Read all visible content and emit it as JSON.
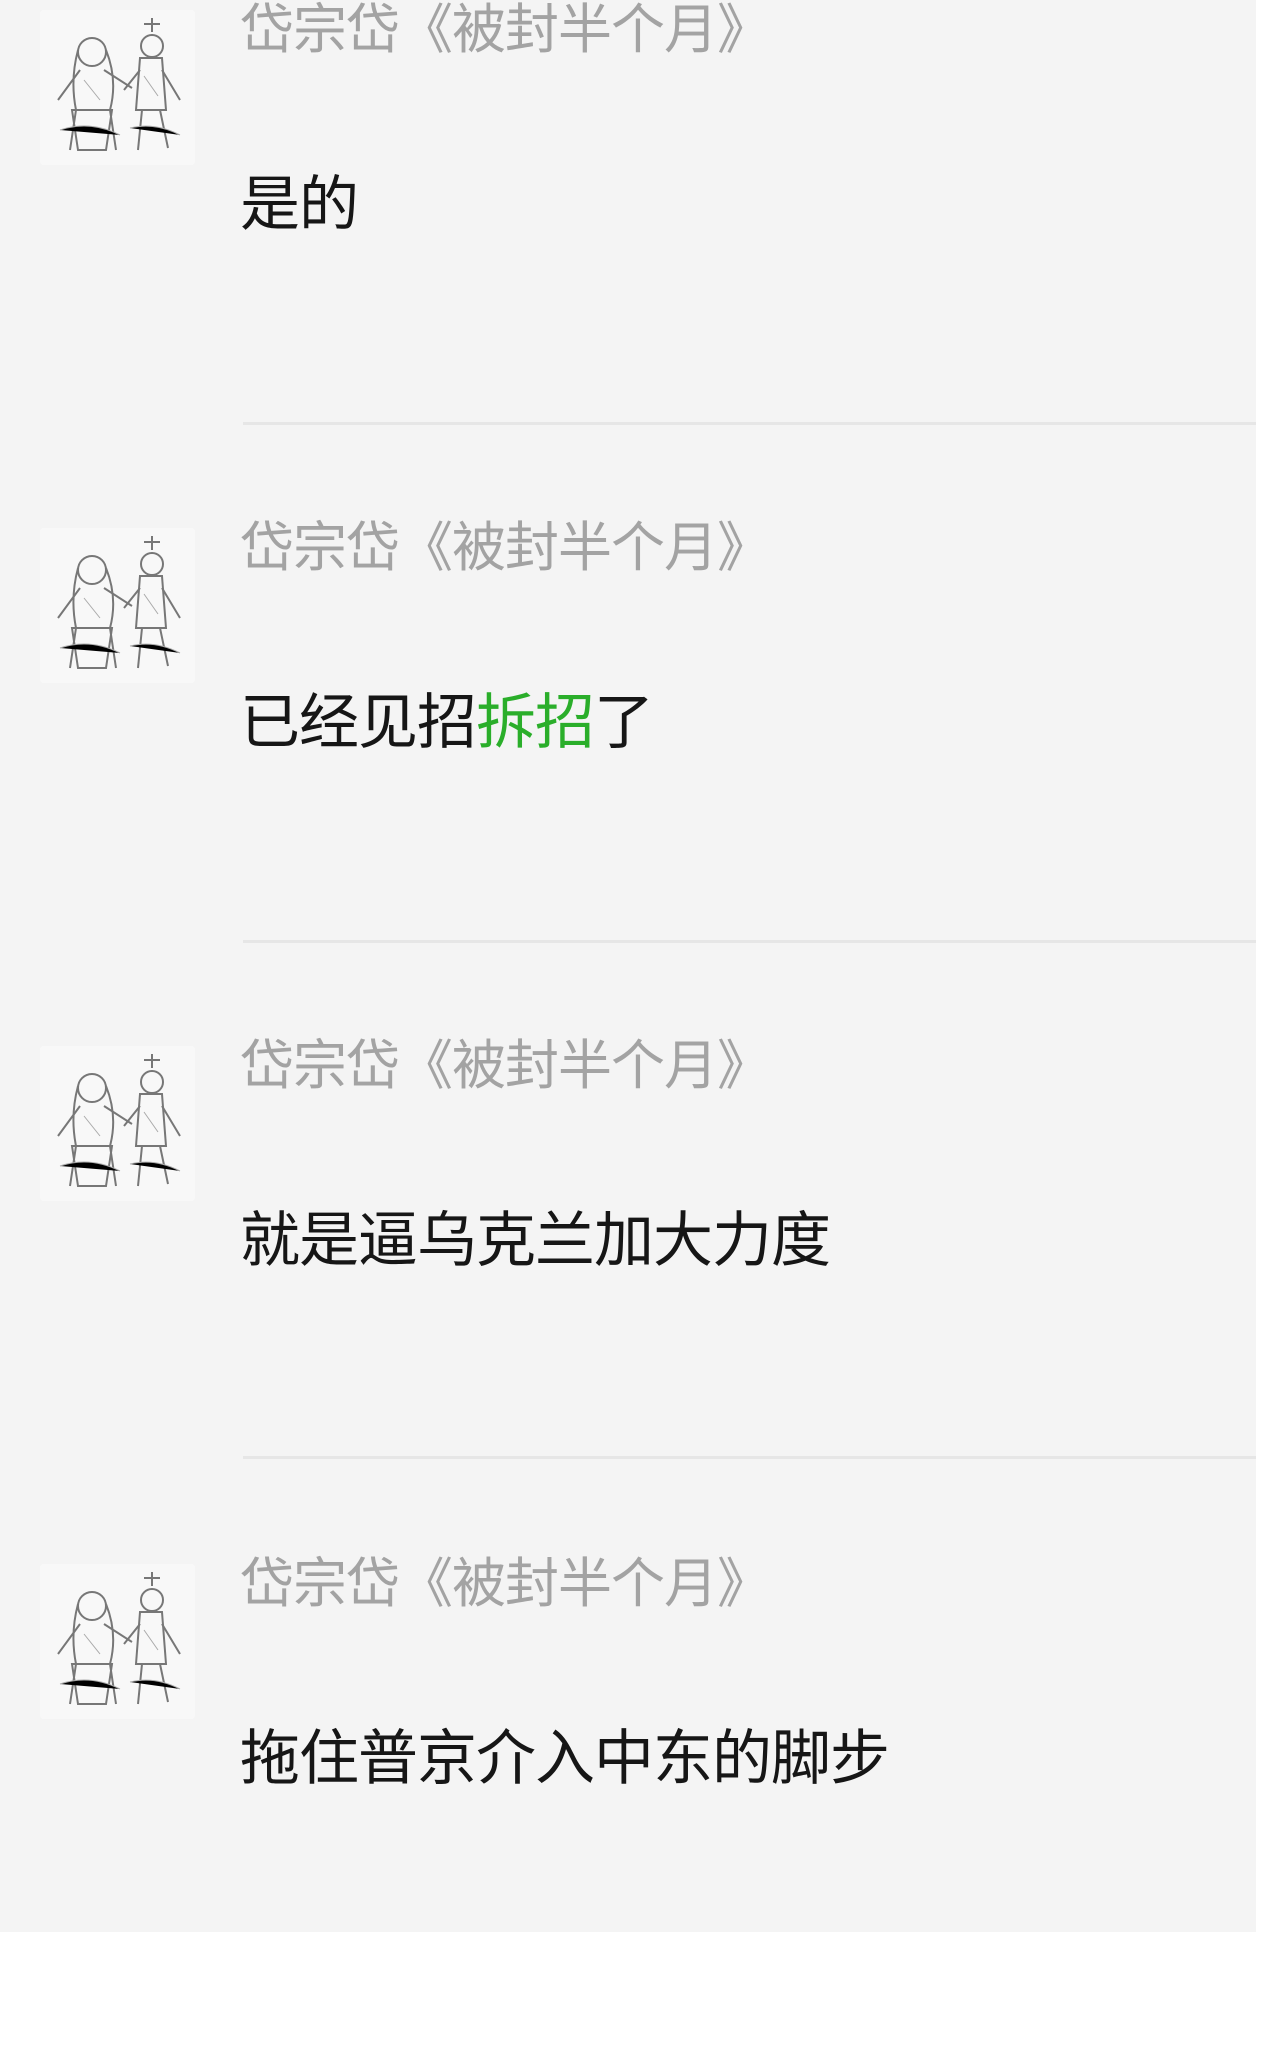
{
  "comments": [
    {
      "author": "岱宗岱《被封半个月》",
      "text_before": "是的",
      "text_highlight": "",
      "text_after": ""
    },
    {
      "author": "岱宗岱《被封半个月》",
      "text_before": "已经见招",
      "text_highlight": "拆招",
      "text_after": "了"
    },
    {
      "author": "岱宗岱《被封半个月》",
      "text_before": "就是逼乌克兰加大力度",
      "text_highlight": "",
      "text_after": ""
    },
    {
      "author": "岱宗岱《被封半个月》",
      "text_before": "拖住普京介入中东的脚步",
      "text_highlight": "",
      "text_after": ""
    }
  ],
  "colors": {
    "background": "#f4f4f4",
    "author": "#a3a3a3",
    "text": "#161616",
    "highlight": "#2aae2a",
    "divider": "#e6e6e6"
  },
  "icons": {
    "avatar": "sketch-avatar-two-figures"
  }
}
